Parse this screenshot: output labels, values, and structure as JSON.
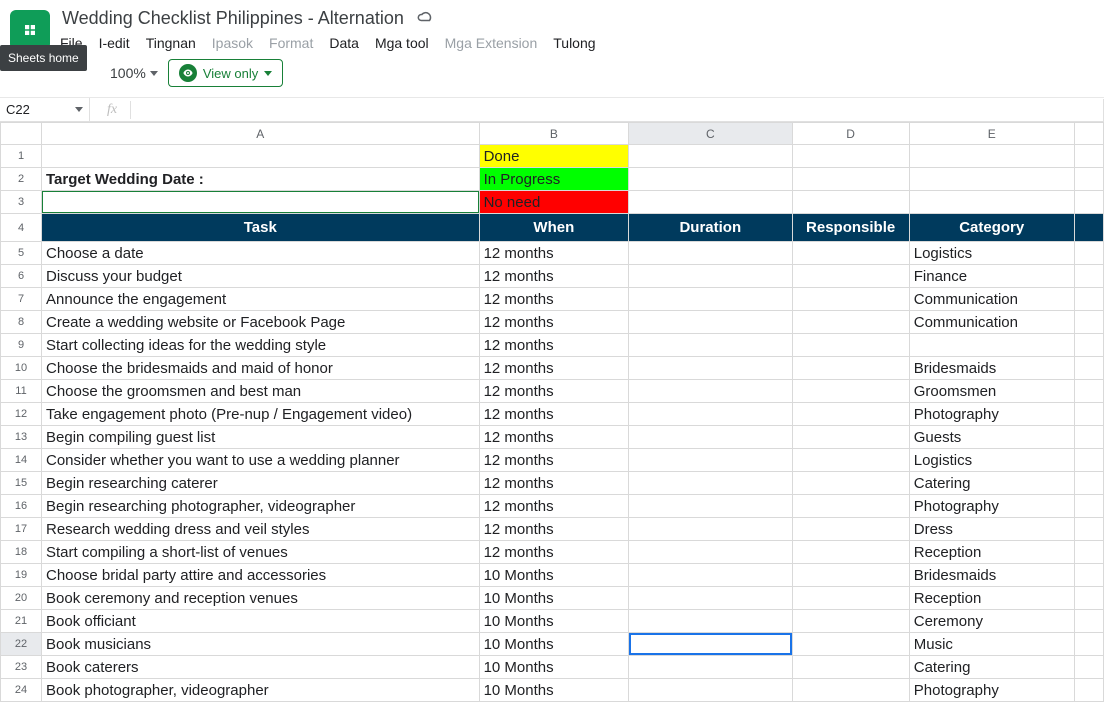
{
  "tooltip": "Sheets home",
  "doc_title": "Wedding Checklist Philippines - Alternation",
  "menu": {
    "file": "File",
    "edit": "I-edit",
    "view": "Tingnan",
    "insert": "Ipasok",
    "format": "Format",
    "data": "Data",
    "tools": "Mga tool",
    "extensions": "Mga Extension",
    "help": "Tulong"
  },
  "toolbar": {
    "zoom": "100%",
    "view_only": "View only"
  },
  "namebox": "C22",
  "fx_label": "fx",
  "columns": [
    "A",
    "B",
    "C",
    "D",
    "E"
  ],
  "status": {
    "done": "Done",
    "prog": "In Progress",
    "none": "No need"
  },
  "target_label": "Target Wedding Date :",
  "headers": {
    "task": "Task",
    "when": "When",
    "duration": "Duration",
    "responsible": "Responsible",
    "category": "Category"
  },
  "rows": [
    {
      "num": 5,
      "task": "Choose a date",
      "when": "12 months",
      "dur": "",
      "resp": "",
      "cat": "Logistics"
    },
    {
      "num": 6,
      "task": "Discuss your budget",
      "when": "12 months",
      "dur": "",
      "resp": "",
      "cat": "Finance"
    },
    {
      "num": 7,
      "task": "Announce the engagement",
      "when": "12 months",
      "dur": "",
      "resp": "",
      "cat": "Communication"
    },
    {
      "num": 8,
      "task": "Create a wedding website or Facebook Page",
      "when": "12 months",
      "dur": "",
      "resp": "",
      "cat": "Communication"
    },
    {
      "num": 9,
      "task": "Start collecting ideas for the wedding style",
      "when": "12 months",
      "dur": "",
      "resp": "",
      "cat": ""
    },
    {
      "num": 10,
      "task": "Choose the bridesmaids and maid of honor",
      "when": "12 months",
      "dur": "",
      "resp": "",
      "cat": "Bridesmaids"
    },
    {
      "num": 11,
      "task": "Choose the groomsmen and best man",
      "when": "12 months",
      "dur": "",
      "resp": "",
      "cat": "Groomsmen"
    },
    {
      "num": 12,
      "task": "Take engagement photo (Pre-nup / Engagement video)",
      "when": "12 months",
      "dur": "",
      "resp": "",
      "cat": "Photography"
    },
    {
      "num": 13,
      "task": "Begin compiling guest list",
      "when": "12 months",
      "dur": "",
      "resp": "",
      "cat": "Guests"
    },
    {
      "num": 14,
      "task": "Consider whether you want to use a wedding planner",
      "when": "12 months",
      "dur": "",
      "resp": "",
      "cat": "Logistics"
    },
    {
      "num": 15,
      "task": "Begin researching caterer",
      "when": "12 months",
      "dur": "",
      "resp": "",
      "cat": "Catering"
    },
    {
      "num": 16,
      "task": "Begin researching photographer, videographer",
      "when": "12 months",
      "dur": "",
      "resp": "",
      "cat": "Photography"
    },
    {
      "num": 17,
      "task": "Research wedding dress and veil styles",
      "when": "12 months",
      "dur": "",
      "resp": "",
      "cat": "Dress"
    },
    {
      "num": 18,
      "task": "Start compiling a short-list of venues",
      "when": "12 months",
      "dur": "",
      "resp": "",
      "cat": "Reception"
    },
    {
      "num": 19,
      "task": "Choose bridal party attire and accessories",
      "when": "10 Months",
      "dur": "",
      "resp": "",
      "cat": "Bridesmaids"
    },
    {
      "num": 20,
      "task": "Book ceremony and reception venues",
      "when": "10 Months",
      "dur": "",
      "resp": "",
      "cat": "Reception"
    },
    {
      "num": 21,
      "task": "Book officiant",
      "when": "10 Months",
      "dur": "",
      "resp": "",
      "cat": "Ceremony"
    },
    {
      "num": 22,
      "task": "Book musicians",
      "when": "10 Months",
      "dur": "",
      "resp": "",
      "cat": "Music"
    },
    {
      "num": 23,
      "task": "Book caterers",
      "when": "10 Months",
      "dur": "",
      "resp": "",
      "cat": "Catering"
    },
    {
      "num": 24,
      "task": "Book photographer, videographer",
      "when": "10 Months",
      "dur": "",
      "resp": "",
      "cat": "Photography"
    }
  ]
}
